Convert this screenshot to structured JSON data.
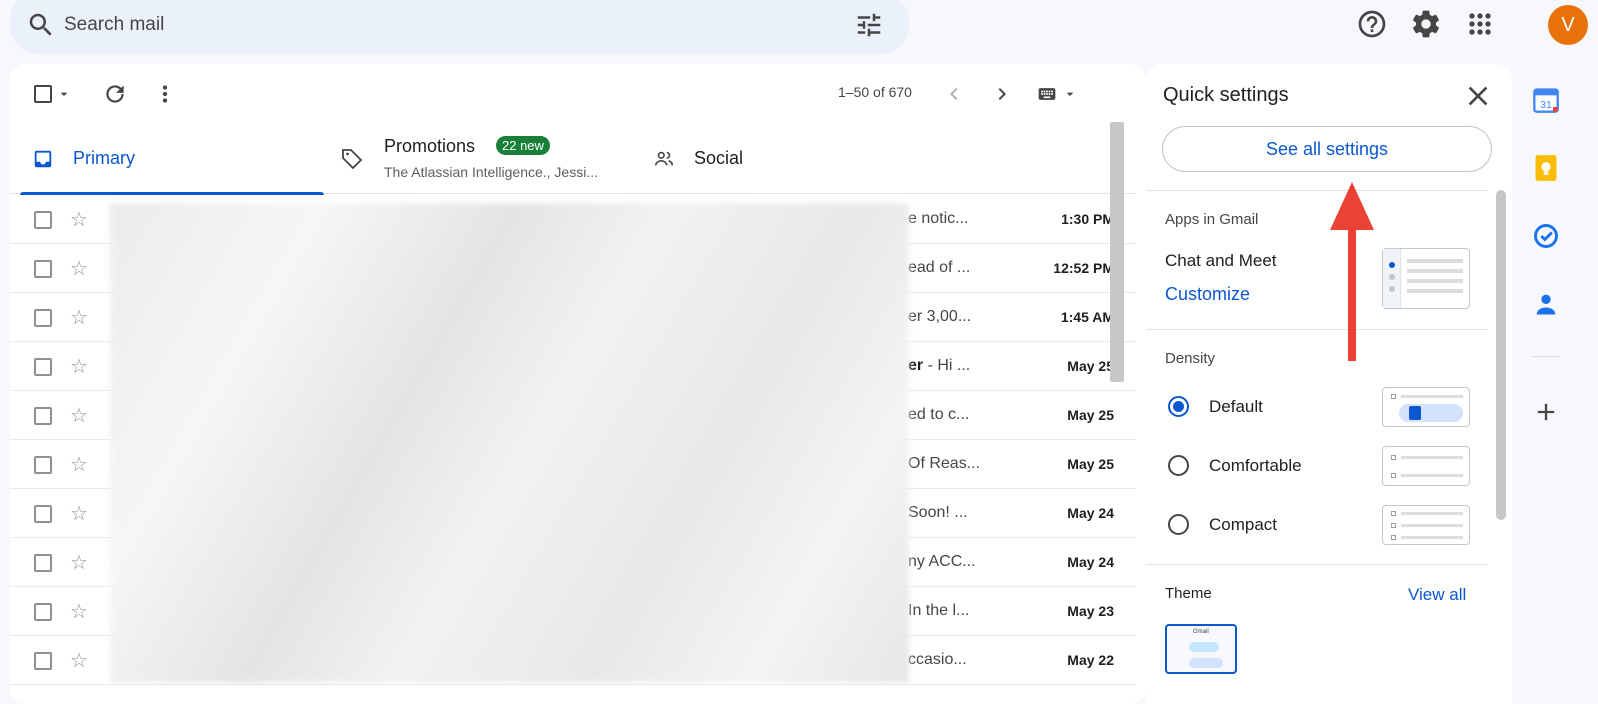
{
  "search": {
    "placeholder": "Search mail"
  },
  "account": {
    "avatar_letter": "V",
    "avatar_color": "#e8710a"
  },
  "toolbar": {
    "pagination": "1–50 of 670"
  },
  "tabs": [
    {
      "label": "Primary",
      "active": true
    },
    {
      "label": "Promotions",
      "badge": "22 new",
      "subtitle": "The Atlassian Intelligence., Jessi..."
    },
    {
      "label": "Social"
    }
  ],
  "emails": [
    {
      "snippet": "e notic...",
      "time": "1:30 PM",
      "bold_prefix": ""
    },
    {
      "snippet": "ead of ...",
      "time": "12:52 PM",
      "bold_prefix": ""
    },
    {
      "snippet": "er 3,00...",
      "time": "1:45 AM",
      "bold_prefix": ""
    },
    {
      "snippet": " - Hi ...",
      "time": "May 25",
      "bold_prefix": "er"
    },
    {
      "snippet": "ed to c...",
      "time": "May 25",
      "bold_prefix": ""
    },
    {
      "snippet": "Of Reas...",
      "time": "May 25",
      "bold_prefix": ""
    },
    {
      "snippet": "Soon! ...",
      "time": "May 24",
      "bold_prefix": ""
    },
    {
      "snippet": "ny ACC...",
      "time": "May 24",
      "bold_prefix": ""
    },
    {
      "snippet": "In the l...",
      "time": "May 23",
      "bold_prefix": ""
    },
    {
      "snippet": "ccasio...",
      "time": "May 22",
      "bold_prefix": ""
    }
  ],
  "quick_settings": {
    "title": "Quick settings",
    "see_all": "See all settings",
    "apps_heading": "Apps in Gmail",
    "apps_text": "Chat and Meet",
    "customize": "Customize",
    "density_heading": "Density",
    "density_options": [
      {
        "label": "Default",
        "selected": true
      },
      {
        "label": "Comfortable",
        "selected": false
      },
      {
        "label": "Compact",
        "selected": false
      }
    ],
    "theme_heading": "Theme",
    "view_all": "View all",
    "theme_thumb_label": "Gmail"
  },
  "colors": {
    "accent": "#0b57d0",
    "badge": "#188038",
    "annotation_arrow": "#ea4335"
  }
}
